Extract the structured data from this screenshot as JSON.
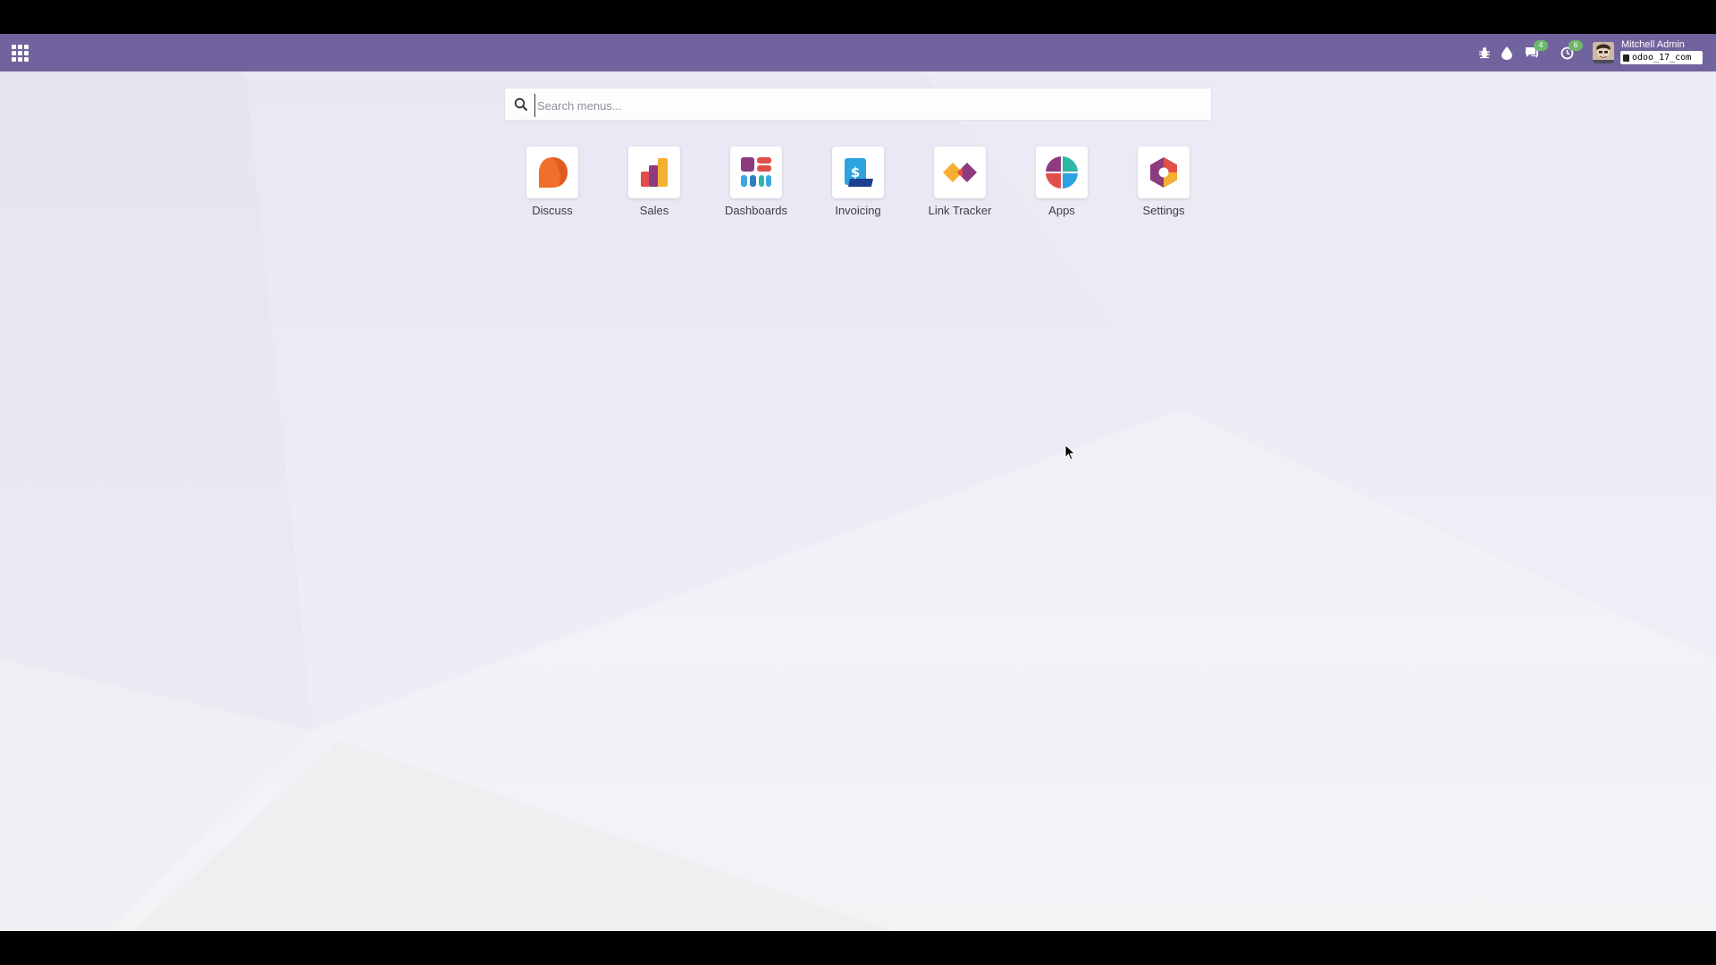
{
  "navbar": {
    "apps_menu_icon": "grid-icon",
    "background": "#71639e",
    "systray": {
      "debug_icon": "bug-icon",
      "theme_icon": "drop-icon",
      "messages": {
        "icon": "chat-icon",
        "count": "4"
      },
      "activities": {
        "icon": "clock-icon",
        "count": "6"
      }
    },
    "user": {
      "name": "Mitchell Admin",
      "database": "odoo_17_com"
    }
  },
  "search": {
    "placeholder": "Search menus...",
    "value": ""
  },
  "apps": [
    {
      "label": "Discuss",
      "icon": "discuss-icon"
    },
    {
      "label": "Sales",
      "icon": "sales-icon"
    },
    {
      "label": "Dashboards",
      "icon": "dashboards-icon"
    },
    {
      "label": "Invoicing",
      "icon": "invoicing-icon"
    },
    {
      "label": "Link Tracker",
      "icon": "link-tracker-icon"
    },
    {
      "label": "Apps",
      "icon": "apps-icon"
    },
    {
      "label": "Settings",
      "icon": "settings-icon"
    }
  ],
  "colors": {
    "accent": "#71639e",
    "badge": "#6db86a"
  }
}
